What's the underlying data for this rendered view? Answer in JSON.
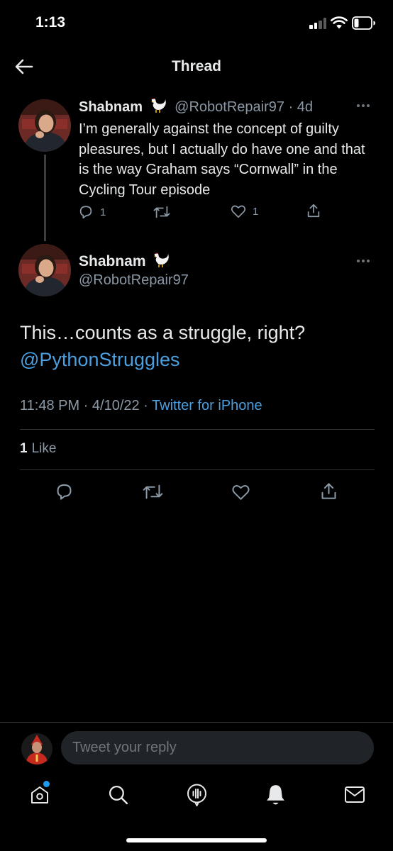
{
  "status_bar": {
    "time": "1:13"
  },
  "header": {
    "title": "Thread"
  },
  "parent_tweet": {
    "name": "Shabnam",
    "handle": "@RobotRepair97",
    "age": "· 4d",
    "text": "I’m generally against the concept of guilty pleasures, but I actually do have one and that is the way Graham says “Cornwall” in the Cycling Tour episode",
    "reply_count": "1",
    "like_count": "1"
  },
  "main_tweet": {
    "name": "Shabnam",
    "handle": "@RobotRepair97",
    "text": "This…counts as a struggle, right?",
    "mention": "@PythonStruggles",
    "time": "11:48 PM · 4/10/22 ·",
    "source": "Twitter for iPhone",
    "like_count": "1",
    "like_label": "Like"
  },
  "reply_bar": {
    "placeholder": "Tweet your reply"
  },
  "icons": {
    "back": "arrow-left-icon",
    "more": "more-horizontal-icon",
    "reply": "reply-icon",
    "retweet": "retweet-icon",
    "like": "heart-icon",
    "share": "share-icon",
    "home": "home-icon",
    "search": "search-icon",
    "spaces": "spaces-icon",
    "notifications": "bell-icon",
    "messages": "mail-icon"
  },
  "colors": {
    "link": "#4a9fe0",
    "muted": "#8b98a5",
    "accent_dot": "#1d9bf0"
  }
}
